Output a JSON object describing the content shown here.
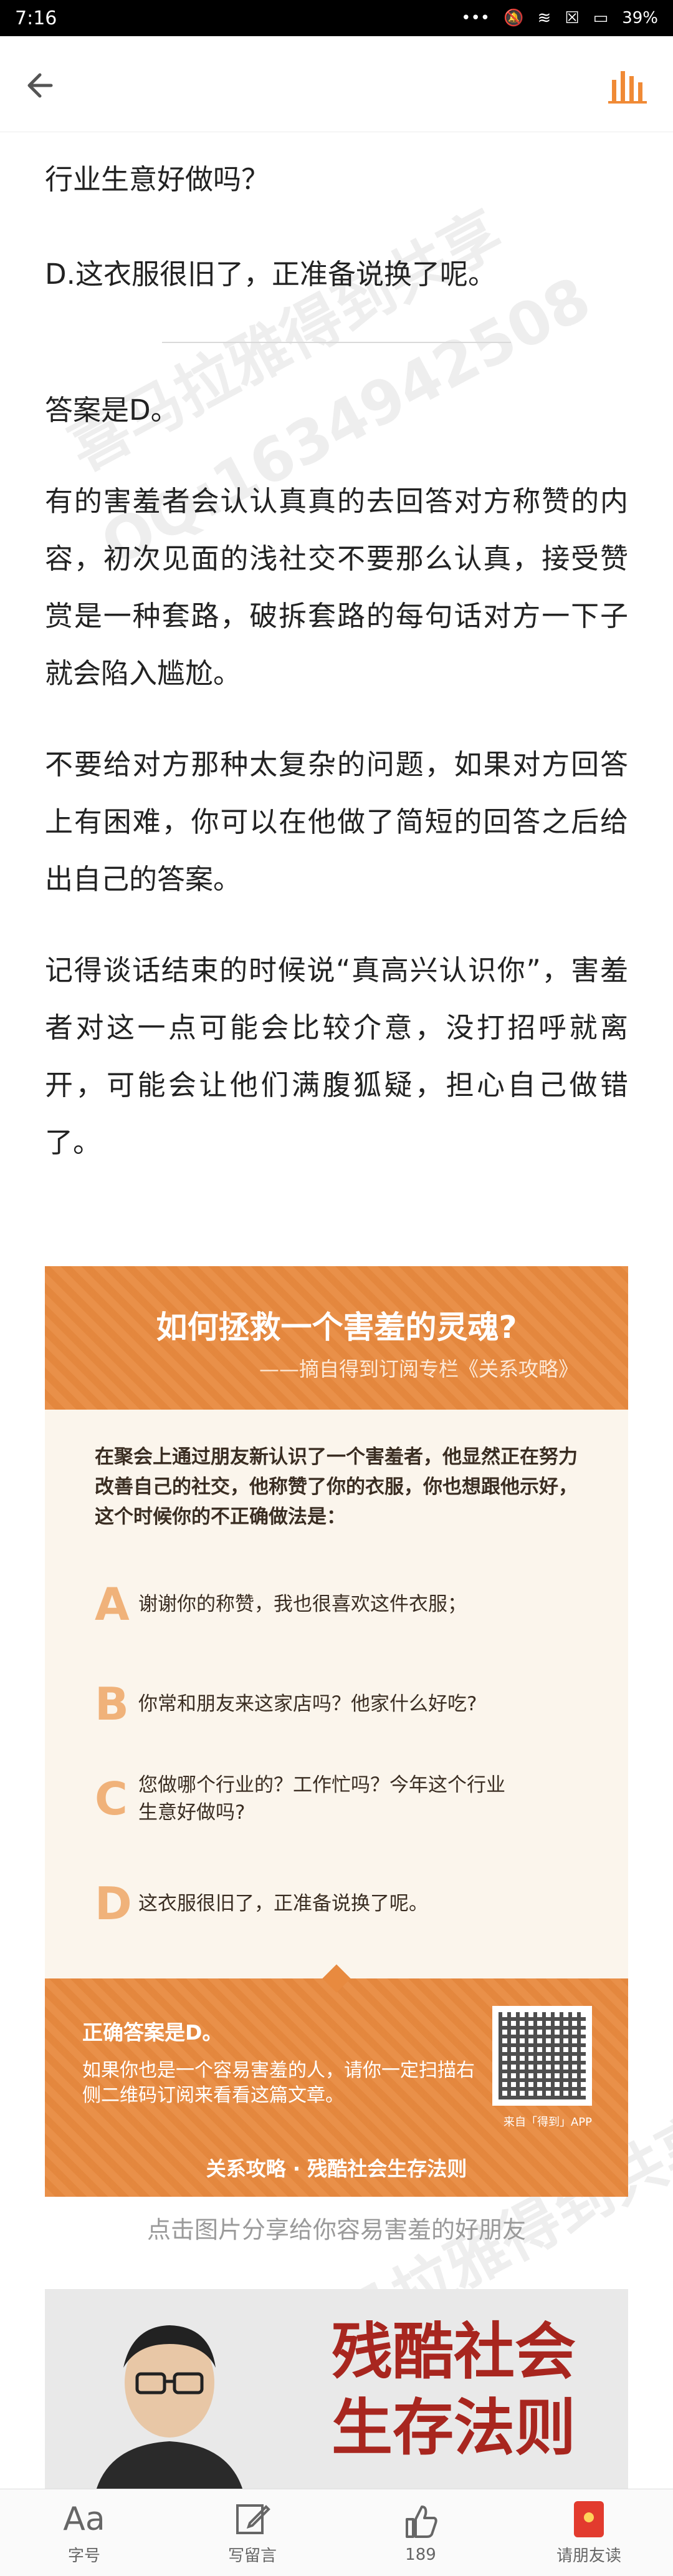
{
  "status": {
    "time": "7:16",
    "battery": "39%"
  },
  "article": {
    "line_intro": "行业生意好做吗？",
    "line_d": "D.这衣服很旧了，正准备说换了呢。",
    "answer": "答案是D。",
    "paragraphs": [
      "有的害羞者会认认真真的去回答对方称赞的内容，初次见面的浅社交不要那么认真，接受赞赏是一种套路，破拆套路的每句话对方一下子就会陷入尴尬。",
      "不要给对方那种太复杂的问题，如果对方回答上有困难，你可以在他做了简短的回答之后给出自己的答案。",
      "记得谈话结束的时候说“真高兴认识你”，害羞者对这一点可能会比较介意，没打招呼就离开，可能会让他们满腹狐疑，担心自己做错了。"
    ]
  },
  "watermark": {
    "line1": "喜马拉雅得到共享",
    "line2": "QQ:1634942508"
  },
  "infographic": {
    "title": "如何拯救一个害羞的灵魂?",
    "subtitle": "——摘自得到订阅专栏《关系攻略》",
    "question": "在聚会上通过朋友新认识了一个害羞者，他显然正在努力改善自己的社交，他称赞了你的衣服，你也想跟他示好，这个时候你的不正确做法是：",
    "options": [
      {
        "letter": "A",
        "text": "谢谢你的称赞，我也很喜欢这件衣服；"
      },
      {
        "letter": "B",
        "text": "你常和朋友来这家店吗？他家什么好吃?"
      },
      {
        "letter": "C",
        "text": "您做哪个行业的？工作忙吗？今年这个行业生意好做吗?"
      },
      {
        "letter": "D",
        "text": "这衣服很旧了，正准备说换了呢。"
      }
    ],
    "correct": "正确答案是D。",
    "hint": "如果你也是一个容易害羞的人，请你一定扫描右侧二维码订阅来看看这篇文章。",
    "qr_caption": "来自「得到」APP",
    "footer": "关系攻略 · 残酷社会生存法则"
  },
  "caption": "点击图片分享给你容易害羞的好朋友",
  "book_title": [
    "残酷社会",
    "生存法则"
  ],
  "tabs": [
    {
      "icon": "font-size-icon",
      "label": "字号"
    },
    {
      "icon": "write-comment-icon",
      "label": "写留言"
    },
    {
      "icon": "thumbs-up-icon",
      "label": "189"
    },
    {
      "icon": "red-packet-icon",
      "label": "请朋友读"
    }
  ]
}
